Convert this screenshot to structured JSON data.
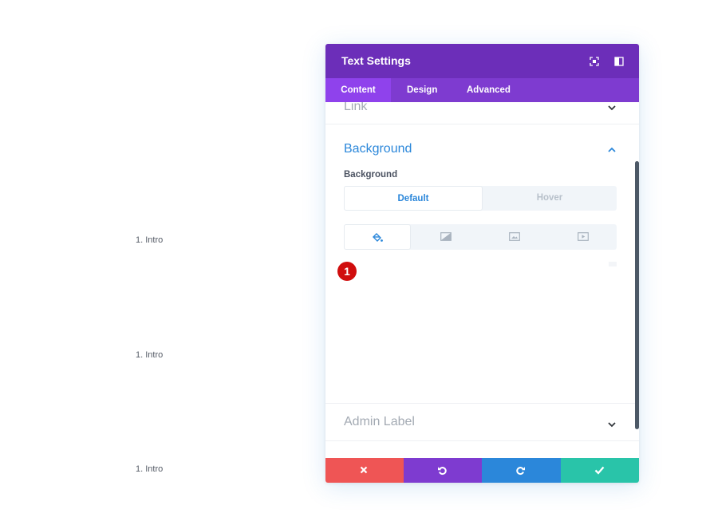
{
  "page": {
    "intro_items": [
      "1. Intro",
      "1. Intro",
      "1. Intro"
    ]
  },
  "modal": {
    "title": "Text Settings",
    "header_icons": [
      "expand-icon",
      "split-view-icon"
    ],
    "tabs": [
      {
        "label": "Content",
        "active": true
      },
      {
        "label": "Design",
        "active": false
      },
      {
        "label": "Advanced",
        "active": false
      }
    ],
    "link_toggle": {
      "title": "Link"
    },
    "background_section": {
      "title": "Background",
      "field_label": "Background",
      "state_tabs": [
        {
          "label": "Default",
          "active": true
        },
        {
          "label": "Hover",
          "active": false
        }
      ],
      "type_buttons": [
        "paint-bucket-icon",
        "gradient-icon",
        "image-icon",
        "video-icon"
      ]
    },
    "marker": "1",
    "admin_toggle": {
      "title": "Admin Label"
    },
    "footer_buttons": [
      "close-icon",
      "undo-icon",
      "redo-icon",
      "check-icon"
    ]
  },
  "colors": {
    "header": "#6c2eb9",
    "tabs": "#7e3bd0",
    "active_tab": "#8f42ec",
    "accent": "#2b87da",
    "cancel": "#ef5555",
    "save": "#29c4a9",
    "marker": "#d00d0d"
  }
}
